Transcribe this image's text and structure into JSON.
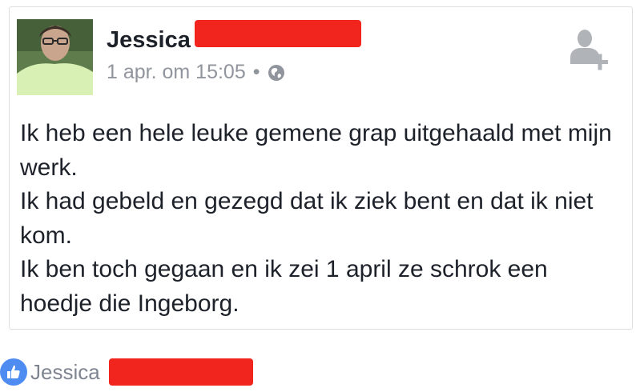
{
  "post": {
    "author_name": "Jessica",
    "timestamp": "1 apr. om 15:05",
    "separator": "•",
    "privacy_icon": "globe-icon",
    "add_friend_icon": "add-friend-icon",
    "text_lines": [
      "Ik heb een hele leuke gemene grap uitgehaald met mijn werk.",
      "Ik had gebeld en gezegd dat ik ziek bent en dat ik niet kom.",
      "Ik ben toch gegaan en ik zei 1 april ze schrok een hoedje die Ingeborg."
    ]
  },
  "reactions": {
    "icon": "like-icon",
    "name": "Jessica"
  },
  "colors": {
    "redaction": "#f2251e",
    "like_blue": "#4e8cf1",
    "meta_gray": "#90949c",
    "text": "#1d2129"
  }
}
